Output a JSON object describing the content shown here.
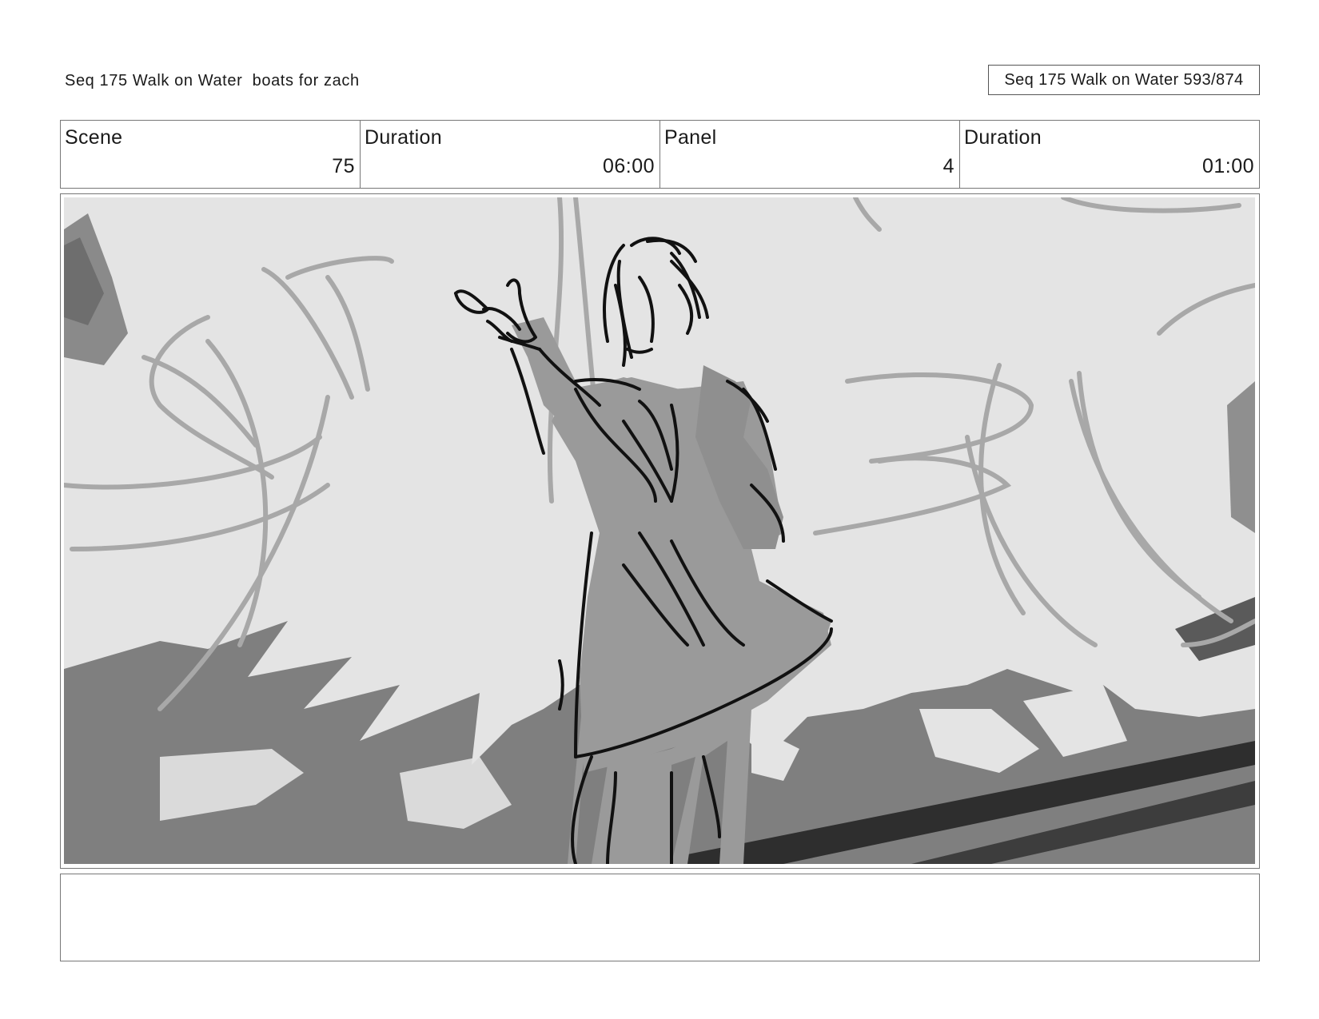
{
  "header": {
    "title": "Seq 175 Walk on Water  boats for zach",
    "page_ref": "Seq 175 Walk on Water 593/874"
  },
  "info": {
    "scene_label": "Scene",
    "scene_value": "75",
    "scene_duration_label": "Duration",
    "scene_duration_value": "06:00",
    "panel_label": "Panel",
    "panel_value": "4",
    "panel_duration_label": "Duration",
    "panel_duration_value": "01:00"
  },
  "panel": {
    "art_description_icon": "storyboard-sketch-figure-reaching",
    "colors": {
      "sky": "#e4e4e4",
      "ground": "#7f7f7f",
      "figure_fill": "#9a9a9a",
      "ink": "#111111",
      "rough": "#a8a8a8"
    }
  },
  "notes": {
    "text": ""
  }
}
